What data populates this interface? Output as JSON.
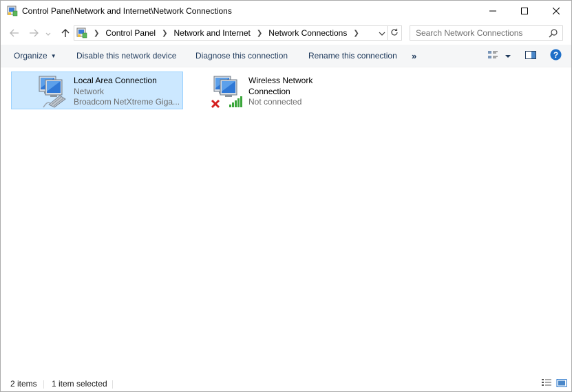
{
  "window": {
    "title": "Control Panel\\Network and Internet\\Network Connections",
    "minimize_icon": "minimize-icon",
    "maximize_icon": "maximize-icon",
    "close_icon": "close-icon"
  },
  "navigation": {
    "back_icon": "arrow-left-icon",
    "forward_icon": "arrow-right-icon",
    "recent_icon": "chevron-down-icon",
    "up_icon": "arrow-up-icon"
  },
  "address": {
    "breadcrumbs": [
      "Control Panel",
      "Network and Internet",
      "Network Connections"
    ],
    "location_icon": "control-panel-network-icon"
  },
  "search": {
    "placeholder": "Search Network Connections",
    "value": ""
  },
  "commands": {
    "organize": "Organize",
    "disable": "Disable this network device",
    "diagnose": "Diagnose this connection",
    "rename": "Rename this connection",
    "more": "»"
  },
  "connections": [
    {
      "name": "Local Area Connection",
      "status": "Network",
      "device": "Broadcom NetXtreme Giga...",
      "selected": true,
      "icon": "ethernet-connection-icon"
    },
    {
      "name_line1": "Wireless Network",
      "name_line2": "Connection",
      "status": "Not connected",
      "selected": false,
      "icon": "wireless-connection-icon"
    }
  ],
  "status": {
    "item_count": "2 items",
    "selection": "1 item selected"
  },
  "colors": {
    "selection_bg": "#cce8ff",
    "selection_border": "#99d1ff",
    "command_text": "#1e395b",
    "help_blue": "#1e6fc8"
  }
}
